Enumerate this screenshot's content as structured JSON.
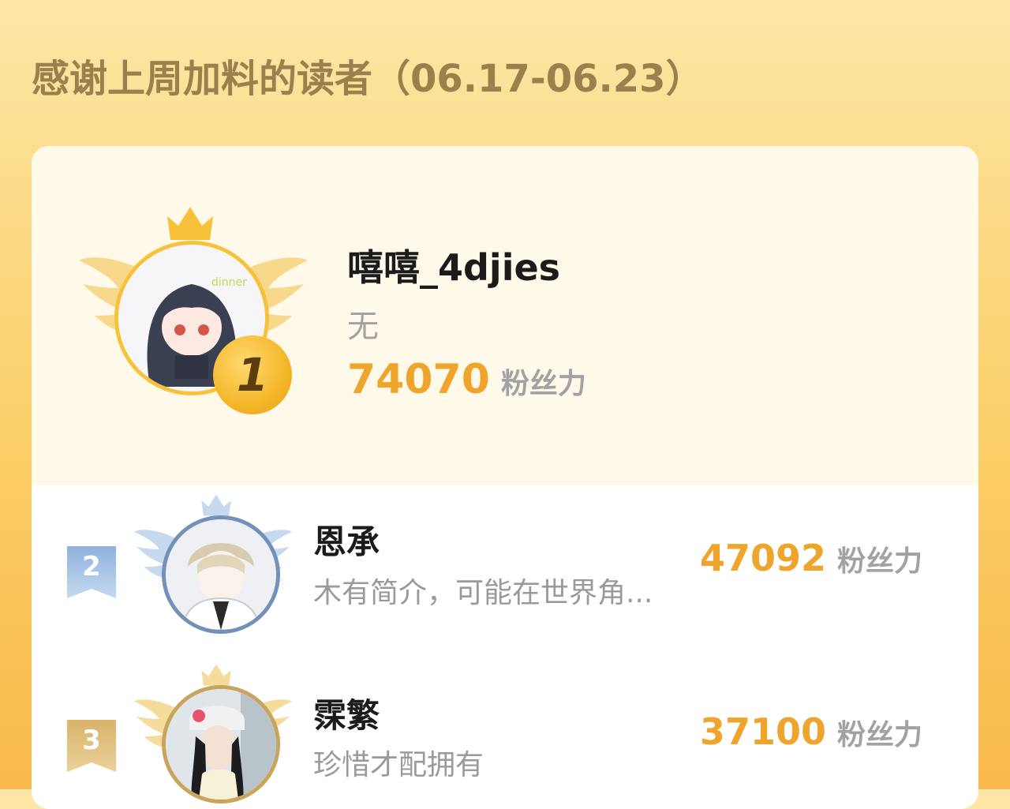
{
  "header": {
    "title": "感谢上周加料的读者（06.17-06.23）"
  },
  "colors": {
    "accent": "#efa52c",
    "gold": "#f7c23a",
    "silver": "#7391b8",
    "title": "#9c7f4c",
    "background_top": "#fde6a6",
    "background_bottom": "#f9b94c"
  },
  "leaderboard": {
    "first": {
      "rank": "1",
      "name": "嘻嘻_4djies",
      "bio": "无",
      "score": "74070",
      "unit": "粉丝力",
      "avatar_icon": "anime-girl-avatar-icon"
    },
    "rows": [
      {
        "rank": "2",
        "name": "恩承",
        "bio": "木有简介，可能在世界角...",
        "score": "47092",
        "unit": "粉丝力",
        "avatar_icon": "anime-boy-avatar-icon"
      },
      {
        "rank": "3",
        "name": "霂繁",
        "bio": "珍惜才配拥有",
        "score": "37100",
        "unit": "粉丝力",
        "avatar_icon": "photo-avatar-icon"
      }
    ]
  }
}
